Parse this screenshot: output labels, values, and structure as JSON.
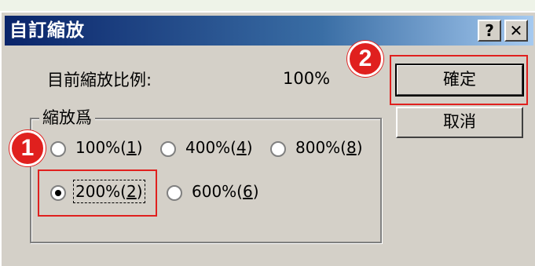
{
  "dialog": {
    "title": "自訂縮放",
    "help_label": "?",
    "close_label": "✕",
    "current_zoom_label": "目前縮放比例:",
    "current_zoom_value": "100%",
    "ok_label": "確定",
    "cancel_label": "取消",
    "group_label": "縮放爲",
    "options": [
      {
        "text": "100%(",
        "key": "1",
        "end": ")",
        "selected": false
      },
      {
        "text": "400%(",
        "key": "4",
        "end": ")",
        "selected": false
      },
      {
        "text": "800%(",
        "key": "8",
        "end": ")",
        "selected": false
      },
      {
        "text": "200%(",
        "key": "2",
        "end": ")",
        "selected": true
      },
      {
        "text": "600%(",
        "key": "6",
        "end": ")",
        "selected": false
      }
    ]
  },
  "annotations": {
    "badge_1": "1",
    "badge_2": "2",
    "color": "#e0201e"
  }
}
